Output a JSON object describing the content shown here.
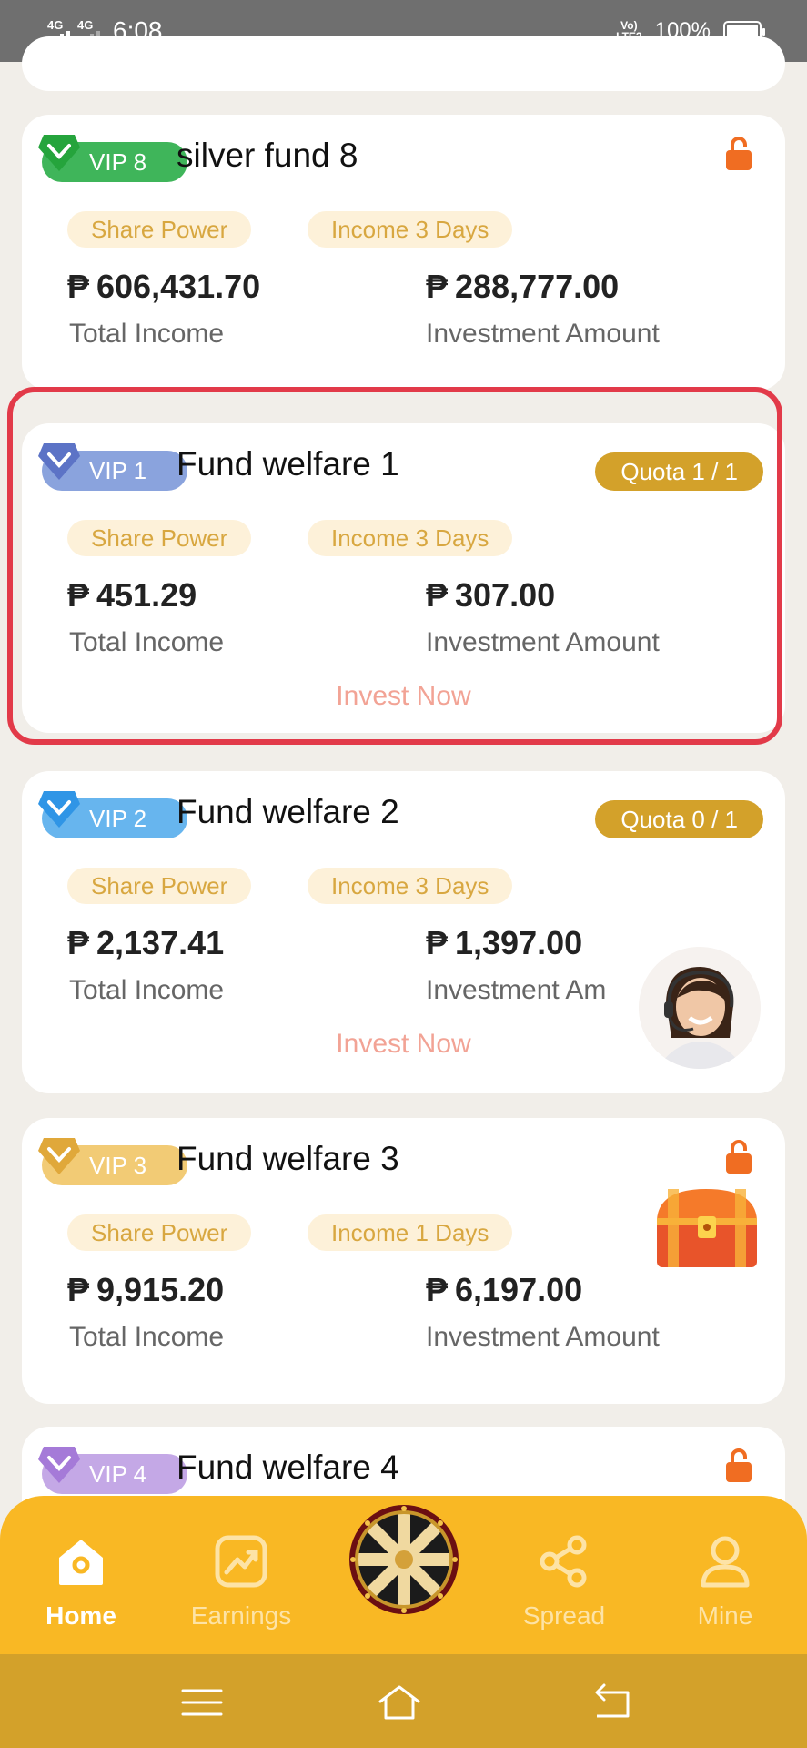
{
  "status_bar": {
    "signal1_label": "4G",
    "signal2_label": "4G",
    "time": "6:08",
    "volte_top": "Vo)",
    "volte_bottom": "LTE2",
    "battery": "100%"
  },
  "cards": [
    {
      "vip_label": "VIP 8",
      "title": "silver fund 8",
      "tags": [
        "Share Power",
        "Income 3 Days"
      ],
      "total_income": "606,431.70",
      "investment_amount": "288,777.00",
      "total_income_label": "Total Income",
      "investment_label": "Investment Amount",
      "locked": true
    },
    {
      "vip_label": "VIP 1",
      "title": "Fund welfare 1",
      "quota": "Quota 1 / 1",
      "tags": [
        "Share Power",
        "Income 3 Days"
      ],
      "total_income": "451.29",
      "investment_amount": "307.00",
      "total_income_label": "Total Income",
      "investment_label": "Investment Amount",
      "action": "Invest Now"
    },
    {
      "vip_label": "VIP 2",
      "title": "Fund welfare 2",
      "quota": "Quota 0 / 1",
      "tags": [
        "Share Power",
        "Income 3 Days"
      ],
      "total_income": "2,137.41",
      "investment_amount": "1,397.00",
      "total_income_label": "Total Income",
      "investment_label": "Investment Am",
      "action": "Invest Now"
    },
    {
      "vip_label": "VIP 3",
      "title": "Fund welfare 3",
      "tags": [
        "Share Power",
        "Income 1 Days"
      ],
      "total_income": "9,915.20",
      "investment_amount": "6,197.00",
      "total_income_label": "Total Income",
      "investment_label": "Investment Amount",
      "locked": true
    },
    {
      "vip_label": "VIP 4",
      "title": "Fund welfare 4",
      "locked": true
    }
  ],
  "currency_symbol": "₱",
  "bottom_nav": {
    "home": "Home",
    "earnings": "Earnings",
    "spread": "Spread",
    "mine": "Mine"
  },
  "icons": {
    "lock": "lock-icon",
    "gem": "diamond-icon",
    "home": "home-icon",
    "earnings": "chart-icon",
    "spread": "share-icon",
    "mine": "user-icon",
    "wheel": "prize-wheel-icon",
    "chest": "treasure-chest-icon",
    "agent": "customer-service-icon"
  },
  "colors": {
    "accent": "#f9b824",
    "quota": "#d3a12a",
    "highlight": "#e23a49",
    "tag_bg": "#fdf1d9",
    "tag_text": "#d8a740",
    "lock": "#f06d22"
  }
}
